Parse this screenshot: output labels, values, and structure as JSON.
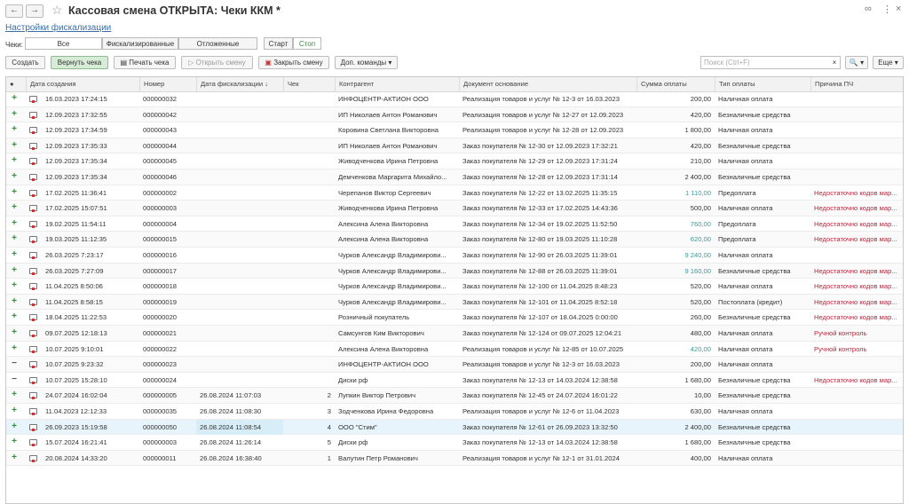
{
  "window": {
    "title": "Кассовая смена ОТКРЫТА: Чеки ККМ *",
    "back_icon": "←",
    "forward_icon": "→",
    "star_icon": "☆",
    "link_icon": "🔗",
    "menu_icon": "⋮",
    "close_icon": "×"
  },
  "settings_link": "Настройки фискализации",
  "filter": {
    "label": "Чеки:",
    "options": [
      "Все",
      "Фискализированные",
      "Отложенные"
    ],
    "selected": "Все",
    "start": "Старт",
    "stop": "Стоп"
  },
  "toolbar": {
    "create": "Создать",
    "return": "Вернуть чека",
    "print": "Печать чека",
    "open_shift": "Открыть смену",
    "close_shift": "Закрыть смену",
    "more": "Доп. команды",
    "search_placeholder": "Поиск (Ctrl+F)",
    "search_clear": "×",
    "search_btn": "🔍 ▾",
    "more2": "Еще ▾"
  },
  "table": {
    "columns": [
      "",
      "Дата создания",
      "Номер",
      "Дата фискализации ↓",
      "Чек",
      "Контрагент",
      "Документ основание",
      "Сумма оплаты",
      "Тип оплаты",
      "Причина ПЧ"
    ],
    "rows": [
      {
        "m": "+",
        "created": "16.03.2023 17:24:15",
        "num": "000000032",
        "fisc": "",
        "check": "",
        "party": "ИНФОЦЕНТР-АКТИОН ООО",
        "doc": "Реализация товаров и услуг № 12-3 от 16.03.2023",
        "sum": "200,00",
        "pay": "Наличная оплата",
        "reason": ""
      },
      {
        "m": "+",
        "created": "12.09.2023 17:32:55",
        "num": "000000042",
        "fisc": "",
        "check": "",
        "party": "ИП Николаев Антон Романович",
        "doc": "Реализация товаров и услуг № 12-27 от 12.09.2023",
        "sum": "420,00",
        "pay": "Безналичные средства",
        "reason": ""
      },
      {
        "m": "+",
        "created": "12.09.2023 17:34:59",
        "num": "000000043",
        "fisc": "",
        "check": "",
        "party": "Коровина Светлана Викторовна",
        "doc": "Реализация товаров и услуг № 12-28 от 12.09.2023",
        "sum": "1 800,00",
        "pay": "Наличная оплата",
        "reason": ""
      },
      {
        "m": "+",
        "created": "12.09.2023 17:35:33",
        "num": "000000044",
        "fisc": "",
        "check": "",
        "party": "ИП Николаев Антон Романович",
        "doc": "Заказ покупателя № 12-30 от 12.09.2023 17:32:21",
        "sum": "420,00",
        "pay": "Безналичные средства",
        "reason": ""
      },
      {
        "m": "+",
        "created": "12.09.2023 17:35:34",
        "num": "000000045",
        "fisc": "",
        "check": "",
        "party": "Живодченкова Ирина Петровна",
        "doc": "Заказ покупателя № 12-29 от 12.09.2023 17:31:24",
        "sum": "210,00",
        "pay": "Наличная оплата",
        "reason": ""
      },
      {
        "m": "+",
        "created": "12.09.2023 17:35:34",
        "num": "000000046",
        "fisc": "",
        "check": "",
        "party": "Демченкова Маргарита Михайло...",
        "doc": "Заказ покупателя № 12-28 от 12.09.2023 17:31:14",
        "sum": "2 400,00",
        "pay": "Безналичные средства",
        "reason": ""
      },
      {
        "m": "+",
        "created": "17.02.2025 11:36:41",
        "num": "000000002",
        "fisc": "",
        "check": "",
        "party": "Черепанов Виктор Сергеевич",
        "doc": "Заказ покупателя № 12-22 от 13.02.2025 11:35:15",
        "sum": "1 110,00",
        "sumc": "teal",
        "pay": "Предоплата",
        "reason": "Недостаточно кодов мар..."
      },
      {
        "m": "+",
        "created": "17.02.2025 15:07:51",
        "num": "000000003",
        "fisc": "",
        "check": "",
        "party": "Живодченкова Ирина Петровна",
        "doc": "Заказ покупателя № 12-33 от 17.02.2025 14:43:36",
        "sum": "500,00",
        "pay": "Наличная оплата",
        "reason": "Недостаточно кодов мар..."
      },
      {
        "m": "+",
        "created": "19.02.2025 11:54:11",
        "num": "000000004",
        "fisc": "",
        "check": "",
        "party": "Алексина Алена Викторовна",
        "doc": "Заказ покупателя № 12-34 от 19.02.2025 11:52:50",
        "sum": "760,00",
        "sumc": "teal",
        "pay": "Предоплата",
        "reason": "Недостаточно кодов мар..."
      },
      {
        "m": "+",
        "created": "19.03.2025 11:12:35",
        "num": "000000015",
        "fisc": "",
        "check": "",
        "party": "Алексина Алена Викторовна",
        "doc": "Заказ покупателя № 12-80 от 19.03.2025 11:10:28",
        "sum": "620,00",
        "sumc": "teal",
        "pay": "Предоплата",
        "reason": "Недостаточно кодов мар..."
      },
      {
        "m": "+",
        "created": "26.03.2025 7:23:17",
        "num": "000000016",
        "fisc": "",
        "check": "",
        "party": "Чурков Александр Владимирови...",
        "doc": "Заказ покупателя № 12-90 от 26.03.2025 11:39:01",
        "sum": "9 240,00",
        "sumc": "teal",
        "pay": "Наличная оплата",
        "reason": ""
      },
      {
        "m": "+",
        "created": "26.03.2025 7:27:09",
        "num": "000000017",
        "fisc": "",
        "check": "",
        "party": "Чурков Александр Владимирови...",
        "doc": "Заказ покупателя № 12-88 от 26.03.2025 11:39:01",
        "sum": "9 160,00",
        "sumc": "teal",
        "pay": "Безналичные средства",
        "reason": "Недостаточно кодов мар..."
      },
      {
        "m": "+",
        "created": "11.04.2025 8:50:06",
        "num": "000000018",
        "fisc": "",
        "check": "",
        "party": "Чурков Александр Владимирови...",
        "doc": "Заказ покупателя № 12-100 от 11.04.2025 8:48:23",
        "sum": "520,00",
        "pay": "Наличная оплата",
        "reason": "Недостаточно кодов мар..."
      },
      {
        "m": "+",
        "created": "11.04.2025 8:58:15",
        "num": "000000019",
        "fisc": "",
        "check": "",
        "party": "Чурков Александр Владимирови...",
        "doc": "Заказ покупателя № 12-101 от 11.04.2025 8:52:18",
        "sum": "520,00",
        "pay": "Постоплата (кредит)",
        "reason": "Недостаточно кодов мар..."
      },
      {
        "m": "+",
        "created": "18.04.2025 11:22:53",
        "num": "000000020",
        "fisc": "",
        "check": "",
        "party": "Розничный покупатель",
        "doc": "Заказ покупателя № 12-107 от 18.04.2025 0:00:00",
        "sum": "260,00",
        "pay": "Безналичные средства",
        "reason": "Недостаточно кодов мар..."
      },
      {
        "m": "+",
        "created": "09.07.2025 12:18:13",
        "num": "000000021",
        "fisc": "",
        "check": "",
        "party": "Самсунгов Ким Викторович",
        "doc": "Заказ покупателя № 12-124 от 09.07.2025 12:04:21",
        "sum": "480,00",
        "pay": "Наличная оплата",
        "reason": "Ручной контроль"
      },
      {
        "m": "+",
        "created": "10.07.2025 9:10:01",
        "num": "000000022",
        "fisc": "",
        "check": "",
        "party": "Алексина Алена Викторовна",
        "doc": "Реализация товаров и услуг № 12-85 от 10.07.2025",
        "sum": "420,00",
        "sumc": "teal",
        "pay": "Наличная оплата",
        "reason": "Ручной контроль"
      },
      {
        "m": "−",
        "created": "10.07.2025 9:23:32",
        "num": "000000023",
        "fisc": "",
        "check": "",
        "party": "ИНФОЦЕНТР-АКТИОН ООО",
        "doc": "Реализация товаров и услуг № 12-3 от 16.03.2023",
        "sum": "200,00",
        "pay": "Наличная оплата",
        "reason": ""
      },
      {
        "m": "−",
        "created": "10.07.2025 15:28:10",
        "num": "000000024",
        "fisc": "",
        "check": "",
        "party": "Диски рф",
        "doc": "Заказ покупателя № 12-13 от 14.03.2024 12:38:58",
        "sum": "1 680,00",
        "pay": "Безналичные средства",
        "reason": "Недостаточно кодов мар..."
      },
      {
        "m": "+",
        "created": "24.07.2024 16:02:04",
        "num": "000000005",
        "fisc": "26.08.2024 11:07:03",
        "check": "2",
        "party": "Лупкин Виктор Петрович",
        "doc": "Заказ покупателя № 12-45 от 24.07.2024 16:01:22",
        "sum": "10,00",
        "pay": "Безналичные средства",
        "reason": ""
      },
      {
        "m": "+",
        "created": "11.04.2023 12:12:33",
        "num": "000000035",
        "fisc": "26.08.2024 11:08:30",
        "check": "3",
        "party": "Зодченкова Ирина Федоровна",
        "doc": "Реализация товаров и услуг № 12-6 от 11.04.2023",
        "sum": "630,00",
        "pay": "Наличная оплата",
        "reason": ""
      },
      {
        "m": "+",
        "created": "26.09.2023 15:19:58",
        "num": "000000050",
        "fisc": "26.08.2024 11:08:54",
        "check": "4",
        "party": "ООО \"Стим\"",
        "doc": "Заказ покупателя № 12-61 от 26.09.2023 13:32:50",
        "sum": "2 400,00",
        "pay": "Безналичные средства",
        "reason": ""
      },
      {
        "m": "+",
        "created": "15.07.2024 16:21:41",
        "num": "000000003",
        "fisc": "26.08.2024 11:26:14",
        "check": "5",
        "party": "Диски рф",
        "doc": "Заказ покупателя № 12-13 от 14.03.2024 12:38:58",
        "sum": "1 680,00",
        "pay": "Безналичные средства",
        "reason": ""
      },
      {
        "m": "+",
        "created": "20.08.2024 14:33:20",
        "num": "000000011",
        "fisc": "26.08.2024 16:38:40",
        "check": "1",
        "party": "Валутин Петр Романович",
        "doc": "Реализация товаров и услуг № 12-1 от 31.01.2024",
        "sum": "400,00",
        "pay": "Наличная оплата",
        "reason": ""
      }
    ]
  }
}
